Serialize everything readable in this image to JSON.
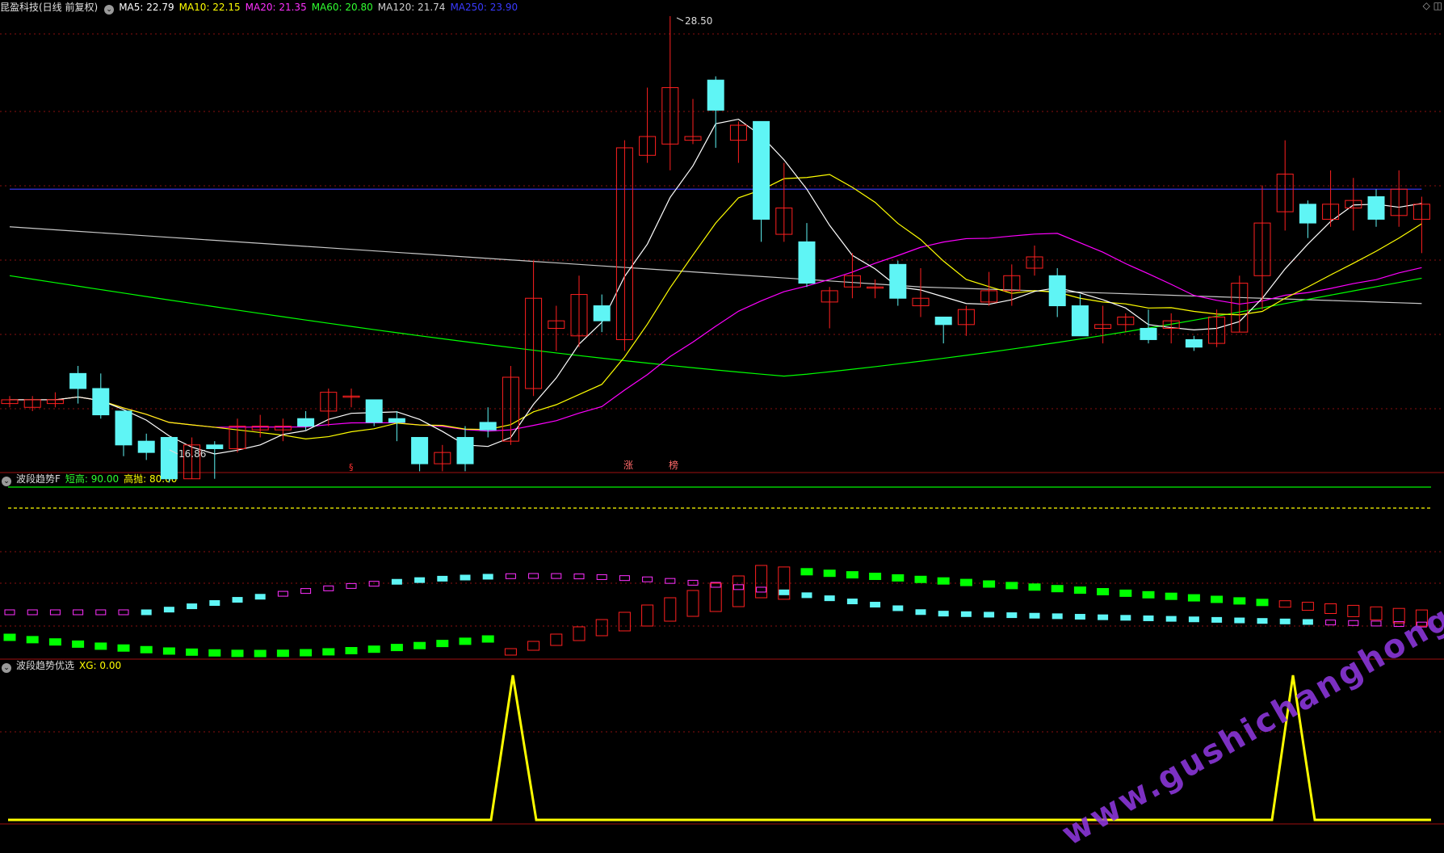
{
  "main_header": {
    "stock": "昆盈科技(日线 前复权)",
    "ma5": "MA5: 22.79",
    "ma10": "MA10: 22.15",
    "ma20": "MA20: 21.35",
    "ma60": "MA60: 20.80",
    "ma120": "MA120: 21.74",
    "ma250": "MA250: 23.90"
  },
  "colors": {
    "ma5": "#ffffff",
    "ma10": "#ffff00",
    "ma20": "#ff00ff",
    "ma60": "#00ff00",
    "ma120": "#c8c8c8",
    "ma250": "#3a3aff",
    "up": "#ff2020",
    "down": "#5ff5f5"
  },
  "annotations": {
    "high": "28.50",
    "low": "16.86"
  },
  "markers": {
    "m1": "§",
    "m2": "涨",
    "m3": "榜"
  },
  "panel2_header": {
    "name": "波段趋势F",
    "l1": "短高: 90.00",
    "l2": "高抛: 80.00"
  },
  "panel3_header": {
    "name": "波段趋势优选",
    "l1": "XG: 0.00"
  },
  "watermark": "www.gushichanghong.com",
  "chart_data": {
    "type": "candlestick",
    "candles": [
      [
        18.2,
        18.3,
        18.1,
        18.4
      ],
      [
        18.1,
        18.3,
        18.0,
        18.4
      ],
      [
        18.2,
        18.3,
        18.1,
        18.5
      ],
      [
        19.0,
        18.6,
        18.2,
        19.2
      ],
      [
        18.6,
        17.9,
        17.8,
        19.0
      ],
      [
        18.0,
        17.1,
        16.8,
        18.0
      ],
      [
        17.2,
        16.9,
        16.7,
        17.4
      ],
      [
        17.3,
        16.2,
        16.1,
        17.3
      ],
      [
        16.2,
        17.1,
        16.2,
        17.3
      ],
      [
        17.1,
        17.0,
        16.2,
        17.2
      ],
      [
        17.0,
        17.6,
        16.9,
        17.8
      ],
      [
        17.5,
        17.6,
        17.3,
        17.9
      ],
      [
        17.5,
        17.6,
        17.2,
        17.8
      ],
      [
        17.8,
        17.6,
        17.5,
        18.0
      ],
      [
        18.0,
        18.5,
        17.6,
        18.6
      ],
      [
        18.4,
        18.4,
        18.1,
        18.6
      ],
      [
        18.3,
        17.7,
        17.6,
        18.3
      ],
      [
        17.8,
        17.7,
        17.2,
        18.0
      ],
      [
        17.3,
        16.6,
        16.4,
        17.3
      ],
      [
        16.6,
        16.9,
        16.4,
        17.1
      ],
      [
        17.3,
        16.6,
        16.4,
        17.6
      ],
      [
        17.7,
        17.5,
        17.3,
        18.1
      ],
      [
        17.2,
        18.9,
        17.1,
        19.2
      ],
      [
        18.6,
        21.0,
        18.4,
        22.0
      ],
      [
        20.2,
        20.4,
        19.6,
        20.8
      ],
      [
        20.0,
        21.1,
        19.7,
        21.6
      ],
      [
        20.8,
        20.4,
        20.1,
        21.1
      ],
      [
        19.9,
        25.0,
        19.6,
        25.2
      ],
      [
        24.8,
        25.3,
        24.6,
        26.6
      ],
      [
        25.1,
        26.6,
        24.4,
        28.5
      ],
      [
        25.2,
        25.3,
        25.1,
        26.3
      ],
      [
        26.8,
        26.0,
        25.0,
        26.9
      ],
      [
        25.2,
        25.6,
        24.6,
        25.7
      ],
      [
        25.7,
        23.1,
        22.5,
        25.7
      ],
      [
        22.7,
        23.4,
        22.5,
        24.6
      ],
      [
        22.5,
        21.4,
        21.3,
        23.0
      ],
      [
        20.9,
        21.2,
        20.2,
        21.3
      ],
      [
        21.3,
        21.6,
        21.0,
        22.2
      ],
      [
        21.3,
        21.3,
        21.0,
        21.5
      ],
      [
        21.9,
        21.0,
        20.8,
        22.0
      ],
      [
        20.8,
        21.0,
        20.5,
        21.8
      ],
      [
        20.5,
        20.3,
        19.8,
        20.5
      ],
      [
        20.3,
        20.7,
        20.0,
        20.8
      ],
      [
        20.9,
        21.2,
        20.8,
        21.7
      ],
      [
        21.2,
        21.6,
        20.8,
        21.9
      ],
      [
        21.8,
        22.1,
        21.6,
        22.4
      ],
      [
        21.6,
        20.8,
        20.5,
        21.8
      ],
      [
        20.8,
        20.0,
        20.0,
        21.1
      ],
      [
        20.2,
        20.3,
        19.8,
        20.8
      ],
      [
        20.3,
        20.5,
        20.1,
        20.6
      ],
      [
        20.2,
        19.9,
        19.8,
        20.7
      ],
      [
        20.2,
        20.4,
        19.8,
        20.6
      ],
      [
        19.9,
        19.7,
        19.6,
        20.0
      ],
      [
        19.8,
        20.5,
        19.7,
        20.7
      ],
      [
        20.1,
        21.4,
        20.1,
        21.6
      ],
      [
        21.6,
        23.0,
        20.7,
        24.0
      ],
      [
        23.3,
        24.3,
        22.8,
        25.2
      ],
      [
        23.5,
        23.0,
        22.6,
        23.6
      ],
      [
        23.1,
        23.5,
        22.9,
        24.4
      ],
      [
        23.4,
        23.6,
        22.8,
        24.2
      ],
      [
        23.7,
        23.1,
        22.9,
        23.9
      ],
      [
        23.2,
        23.9,
        22.9,
        24.4
      ],
      [
        23.1,
        23.5,
        22.2,
        23.7
      ]
    ]
  }
}
